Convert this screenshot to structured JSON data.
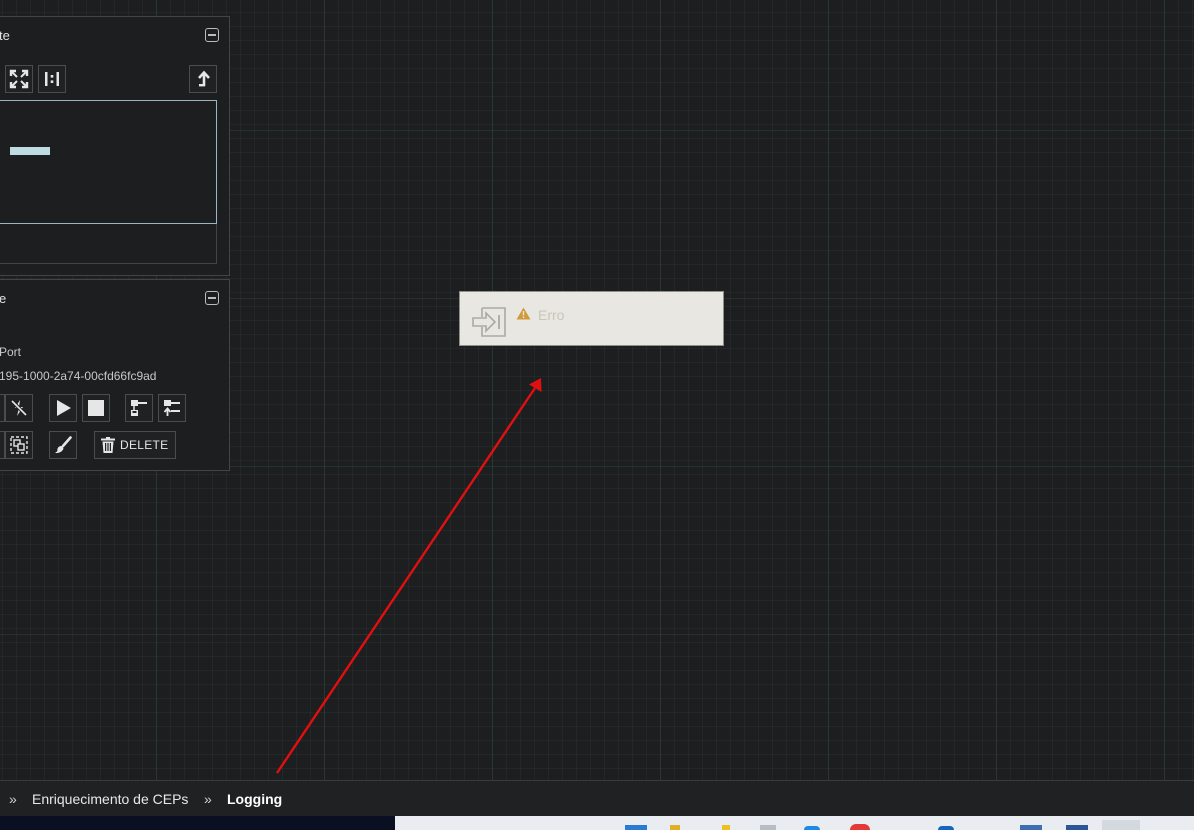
{
  "navigate_panel": {
    "title_fragment": "te",
    "fit_label": "fit-view",
    "actual_size_label": "1:1",
    "leave_group_label": "leave-group"
  },
  "operate_panel": {
    "title_fragment": "e",
    "component_type_fragment": "Port",
    "component_id_fragment": "195-1000-2a74-00cfd66fc9ad",
    "delete_label": "DELETE"
  },
  "canvas": {
    "node": {
      "name": "Erro",
      "status": "warning"
    },
    "annotation_color": "#e01010"
  },
  "breadcrumb": {
    "separator": "»",
    "items": [
      {
        "label": "Enriquecimento de CEPs",
        "current": false
      },
      {
        "label": "Logging",
        "current": true
      }
    ]
  },
  "colors": {
    "canvas_bg": "#1c1e1f",
    "node_bg": "#e8e7e2",
    "node_text": "#c9c6b8",
    "warning": "#d09a3a",
    "birdseye_border": "#9cb6c4",
    "birdseye_indicator": "#bfdbe2"
  }
}
